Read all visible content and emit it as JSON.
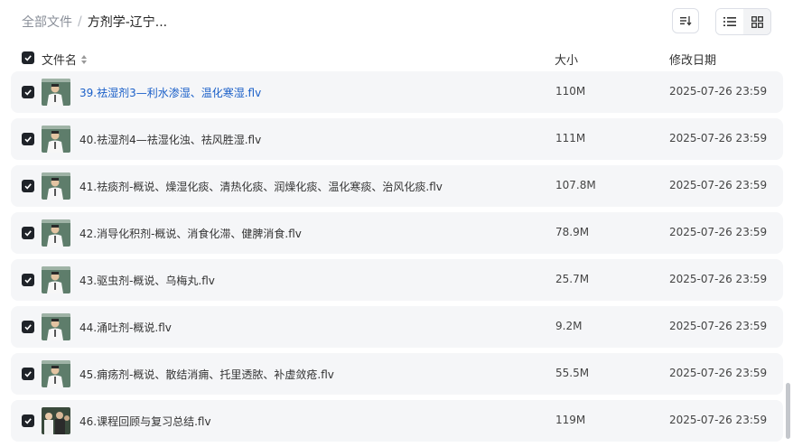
{
  "breadcrumb": {
    "root": "全部文件",
    "separator": "/",
    "current": "方剂学-辽宁..."
  },
  "header": {
    "name_label": "文件名",
    "size_label": "大小",
    "date_label": "修改日期"
  },
  "colors": {
    "checkbox": "#1f2329",
    "link": "#1a5fc8",
    "row_bg": "#f5f6f8"
  },
  "files": [
    {
      "name": "39.祛湿剂3—利水渗湿、温化寒湿.flv",
      "size": "110M",
      "date": "2025-07-26 23:59",
      "thumb": "teacher-video-thumb"
    },
    {
      "name": "40.祛湿剂4—祛湿化浊、祛风胜湿.flv",
      "size": "111M",
      "date": "2025-07-26 23:59",
      "thumb": "teacher-video-thumb"
    },
    {
      "name": "41.祛痰剂-概说、燥湿化痰、清热化痰、润燥化痰、温化寒痰、治风化痰.flv",
      "size": "107.8M",
      "date": "2025-07-26 23:59",
      "thumb": "teacher-video-thumb"
    },
    {
      "name": "42.消导化积剂-概说、消食化滞、健脾消食.flv",
      "size": "78.9M",
      "date": "2025-07-26 23:59",
      "thumb": "teacher-video-thumb"
    },
    {
      "name": "43.驱虫剂-概说、乌梅丸.flv",
      "size": "25.7M",
      "date": "2025-07-26 23:59",
      "thumb": "teacher-video-thumb"
    },
    {
      "name": "44.涌吐剂-概说.flv",
      "size": "9.2M",
      "date": "2025-07-26 23:59",
      "thumb": "teacher-video-thumb"
    },
    {
      "name": "45.痈疡剂-概说、散结消痈、托里透脓、补虚敛疮.flv",
      "size": "55.5M",
      "date": "2025-07-26 23:59",
      "thumb": "teacher-video-thumb"
    },
    {
      "name": "46.课程回顾与复习总结.flv",
      "size": "119M",
      "date": "2025-07-26 23:59",
      "thumb": "classroom-video-thumb"
    }
  ]
}
